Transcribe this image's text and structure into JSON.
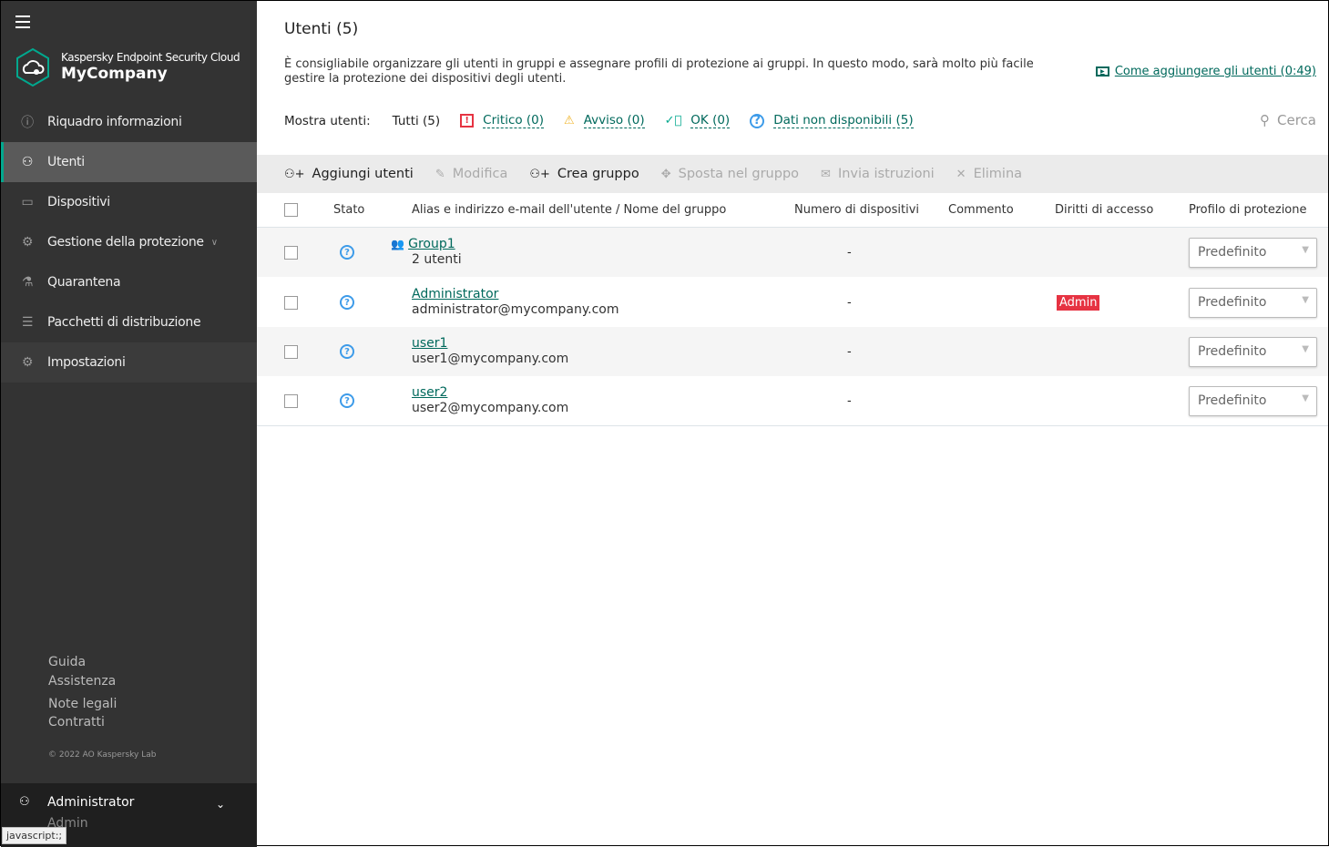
{
  "sidebar": {
    "brand_product": "Kaspersky Endpoint Security Cloud",
    "brand_company": "MyCompany",
    "items": [
      {
        "label": "Riquadro informazioni",
        "icon": "info-icon"
      },
      {
        "label": "Utenti",
        "icon": "user-icon"
      },
      {
        "label": "Dispositivi",
        "icon": "devices-icon"
      },
      {
        "label": "Gestione della protezione",
        "icon": "protection-icon"
      },
      {
        "label": "Quarantena",
        "icon": "flask-icon"
      },
      {
        "label": "Pacchetti di distribuzione",
        "icon": "packages-icon"
      },
      {
        "label": "Impostazioni",
        "icon": "gear-icon"
      }
    ],
    "footer": {
      "guide": "Guida",
      "support": "Assistenza",
      "legal": "Note legali",
      "contracts": "Contratti",
      "copyright": "© 2022 AO Kaspersky Lab"
    },
    "user": {
      "name": "Administrator",
      "role": "Admin"
    },
    "status_bar": "javascript:;"
  },
  "main": {
    "title": "Utenti (5)",
    "description": "È consigliabile organizzare gli utenti in gruppi e assegnare profili di protezione ai gruppi. In questo modo, sarà molto più facile gestire la protezione dei dispositivi degli utenti.",
    "video_link": "Come aggiungere gli utenti (0:49)",
    "filters": {
      "label": "Mostra utenti:",
      "all": "Tutti (5)",
      "critical": "Critico (0)",
      "warning": "Avviso (0)",
      "ok": "OK (0)",
      "unavailable": "Dati non disponibili (5)"
    },
    "search": "Cerca",
    "toolbar": {
      "add": "Aggiungi utenti",
      "edit": "Modifica",
      "create_group": "Crea gruppo",
      "move": "Sposta nel gruppo",
      "send": "Invia istruzioni",
      "delete": "Elimina"
    },
    "columns": {
      "status": "Stato",
      "alias": "Alias e indirizzo e-mail dell'utente / Nome del gruppo",
      "devices": "Numero di dispositivi",
      "comment": "Commento",
      "rights": "Diritti di accesso",
      "profile": "Profilo di protezione"
    },
    "rows": [
      {
        "name": "Group1",
        "sub": "2 utenti",
        "devices": "-",
        "rights": "",
        "profile": "Predefinito"
      },
      {
        "name": "Administrator",
        "sub": "administrator@mycompany.com",
        "devices": "-",
        "rights": "Admin",
        "profile": "Predefinito"
      },
      {
        "name": "user1",
        "sub": "user1@mycompany.com",
        "devices": "-",
        "rights": "",
        "profile": "Predefinito"
      },
      {
        "name": "user2",
        "sub": "user2@mycompany.com",
        "devices": "-",
        "rights": "",
        "profile": "Predefinito"
      }
    ]
  },
  "colors": {
    "accent": "#00a88e",
    "link": "#00695c",
    "critical": "#e63342",
    "warning": "#f0b429",
    "status_unknown": "#3d9be9"
  }
}
